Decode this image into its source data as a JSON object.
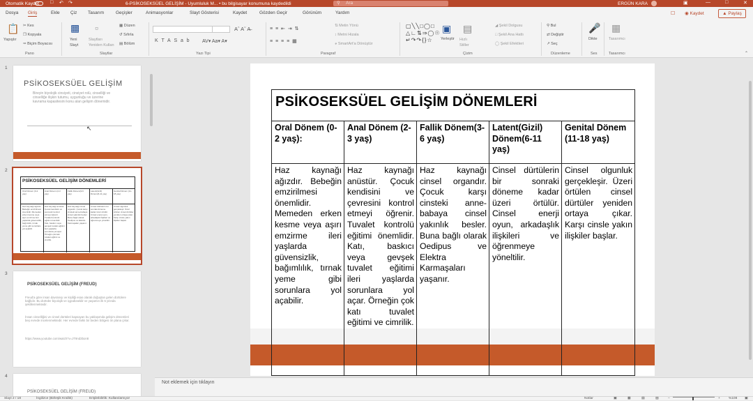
{
  "window": {
    "autosave": "Otomatik Kaydet",
    "title": "6-PSİKOSEKSÜEL GELİŞİM - Uyumluluk M... • bu bilgisayar konumuna kaydedildi",
    "search_placeholder": "Ara",
    "user": "ERGÜN KARA",
    "user_initials": "EK"
  },
  "menu": {
    "items": [
      "Dosya",
      "Giriş",
      "Ekle",
      "Çiz",
      "Tasarım",
      "Geçişler",
      "Animasyonlar",
      "Slayt Gösterisi",
      "Kaydet",
      "Gözden Geçir",
      "Görünüm",
      "Yardım"
    ],
    "active": "Giriş",
    "save": "Kaydet",
    "share": "Paylaş"
  },
  "ribbon": {
    "groups": [
      "Pano",
      "Slaytlar",
      "Yazı Tipi",
      "Paragraf",
      "Çizim",
      "Düzenleme",
      "Ses",
      "Tasarımcı"
    ],
    "pano": {
      "paste": "Yapıştır",
      "cut": "Kes",
      "copy": "Kopyala",
      "format": "Biçim Boyacısı"
    },
    "slaytlar": {
      "new": "Yeni Slayt",
      "reuse": "Slaytları Yeniden Kullan",
      "layout": "Düzen",
      "reset": "Sıfırla",
      "section": "Bölüm"
    },
    "paragraf": {
      "direction": "Metin Yönü",
      "align": "Metni Hizala",
      "smartart": "SmartArt'a Dönüştür"
    },
    "cizim": {
      "arrange": "Yerleştir",
      "styles": "Hızlı Stiller",
      "fill": "Şekil Dolgusu",
      "outline": "Şekil Ana Hattı",
      "effects": "Şekil Efektleri"
    },
    "duzenleme": {
      "find": "Bul",
      "replace": "Değiştir",
      "select": "Seç"
    },
    "ses": {
      "dictate": "Dikte"
    },
    "tasarimci": {
      "designer": "Tasarımcı"
    }
  },
  "thumbnails": {
    "numbers": [
      "1",
      "2",
      "3",
      "4"
    ],
    "s1": {
      "title": "PSİKOSEKSÜEL GELİŞİM",
      "body": "Bireyin biyolojik cinsiyeti, cinsiyet rolü, cinselliği ve cinselliğe ilişkin tutumu, uygunluğu ve üzerine kavrama kapasitesini konu alan gelişim dönemidir."
    },
    "s2": {
      "title": "PSİKOSEKSÜEL GELİŞİM DÖNEMLERİ"
    },
    "s3": {
      "title": "PSİKOSEKSÜEL GELİŞİM (FREUD)",
      "p1": "Freud'a göre insan davranışı ve kişiliği esas olarak doğuştan gelen dürtülere bağlıdır. Bu dürtüler biyolojik ve içgüdüseldir ve yaşamın ilk 5 yılında şekillenmektedir.",
      "p2": "İnsan cinselliğini ve cinsel dürtüleri kapsayan bu yaklaşımda gelişim dönemleri beş evrede incelenmektedir. Her evrede farklı bir beden bölgesi ön plana çıkar.",
      "url": "https://www.youtube.com/watch?v=JT9nd3bon8"
    },
    "s4": {
      "title": "PSİKOSEKSÜEL GELİŞİM (FREUD)"
    }
  },
  "slide": {
    "title": "PSİKOSEKSÜEL GELİŞİM DÖNEMLERİ",
    "columns": [
      {
        "header": "Oral Dönem (0-2 yaş):",
        "body": "Haz kaynağı ağızdır. Bebeğin emzirilmesi önemlidir. Memeden erken kesme veya aşırı emzirme ileri yaşlarda güvensizlik, bağımlılık, tırnak yeme gibi sorunlara yol açabilir."
      },
      {
        "header": "Anal Dönem (2-3 yaş)",
        "body": "Haz kaynağı anüstür. Çocuk kendisini ve çevresini kontrol etmeyi öğrenir. Tuvalet kontrolü eğitimi önemlidir. Katı, baskıcı veya gevşek tuvalet eğitimi ileri yaşlarda sorunlara yol açar. Örneğin çok katı tuvalet eğitimi ve cimrilik."
      },
      {
        "header": "Fallik Dönem(3-6 yaş)",
        "body": "Haz kaynağı cinsel organdır. Çocuk karşı cinsteki anne-babaya cinsel yakınlık besler. Buna bağlı olarak Oedipus ve Elektra Karmaşaları yaşanır."
      },
      {
        "header": "Latent(Gizil) Dönem(6-11 yaş)",
        "body": "Cinsel dürtülerin bir sonraki döneme kadar üzeri örtülür. Cinsel enerji oyun, arkadaşlık ilişkileri ve öğrenmeye yöneltilir."
      },
      {
        "header": "Genital Dönem (11-18 yaş)",
        "body": "Cinsel olgunluk gerçekleşir. Üzeri örtülen cinsel dürtüler yeniden ortaya çıkar. Karşı cinsle yakın ilişkiler başlar."
      }
    ]
  },
  "notes": {
    "placeholder": "Not eklemek için tıklayın"
  },
  "status": {
    "slide": "Slayt 2 / 18",
    "language": "İngilizce (Birleşik Krallık)",
    "accessibility": "Erişilebilirlik: Kullanılamıyor",
    "notes": "Notlar",
    "zoom": "%108"
  },
  "colors": {
    "accent": "#b7472a",
    "band": "#c55a2a"
  }
}
